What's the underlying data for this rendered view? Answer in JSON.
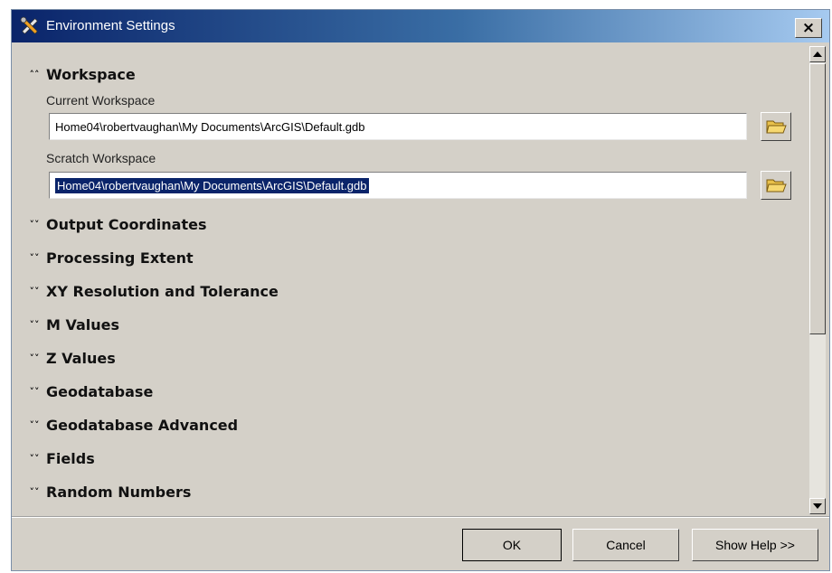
{
  "window": {
    "title": "Environment Settings",
    "close_label": "×"
  },
  "workspace": {
    "header": "Workspace",
    "current_label": "Current Workspace",
    "current_value": "Home04\\robertvaughan\\My Documents\\ArcGIS\\Default.gdb",
    "scratch_label": "Scratch Workspace",
    "scratch_value": "Home04\\robertvaughan\\My Documents\\ArcGIS\\Default.gdb"
  },
  "sections": [
    "Output Coordinates",
    "Processing Extent",
    "XY Resolution and Tolerance",
    "M Values",
    "Z Values",
    "Geodatabase",
    "Geodatabase Advanced",
    "Fields",
    "Random Numbers"
  ],
  "icons": {
    "expand_collapse": "collapse-chevron-icon",
    "collapsed": "expand-chevron-icon",
    "browse": "folder-open-icon",
    "title": "tools-icon"
  },
  "buttons": {
    "ok": "OK",
    "cancel": "Cancel",
    "help": "Show Help >>"
  },
  "colors": {
    "titlebar_start": "#0a246a",
    "titlebar_end": "#a6caf0",
    "dialog_bg": "#d4d0c8",
    "selection": "#0a246a"
  }
}
